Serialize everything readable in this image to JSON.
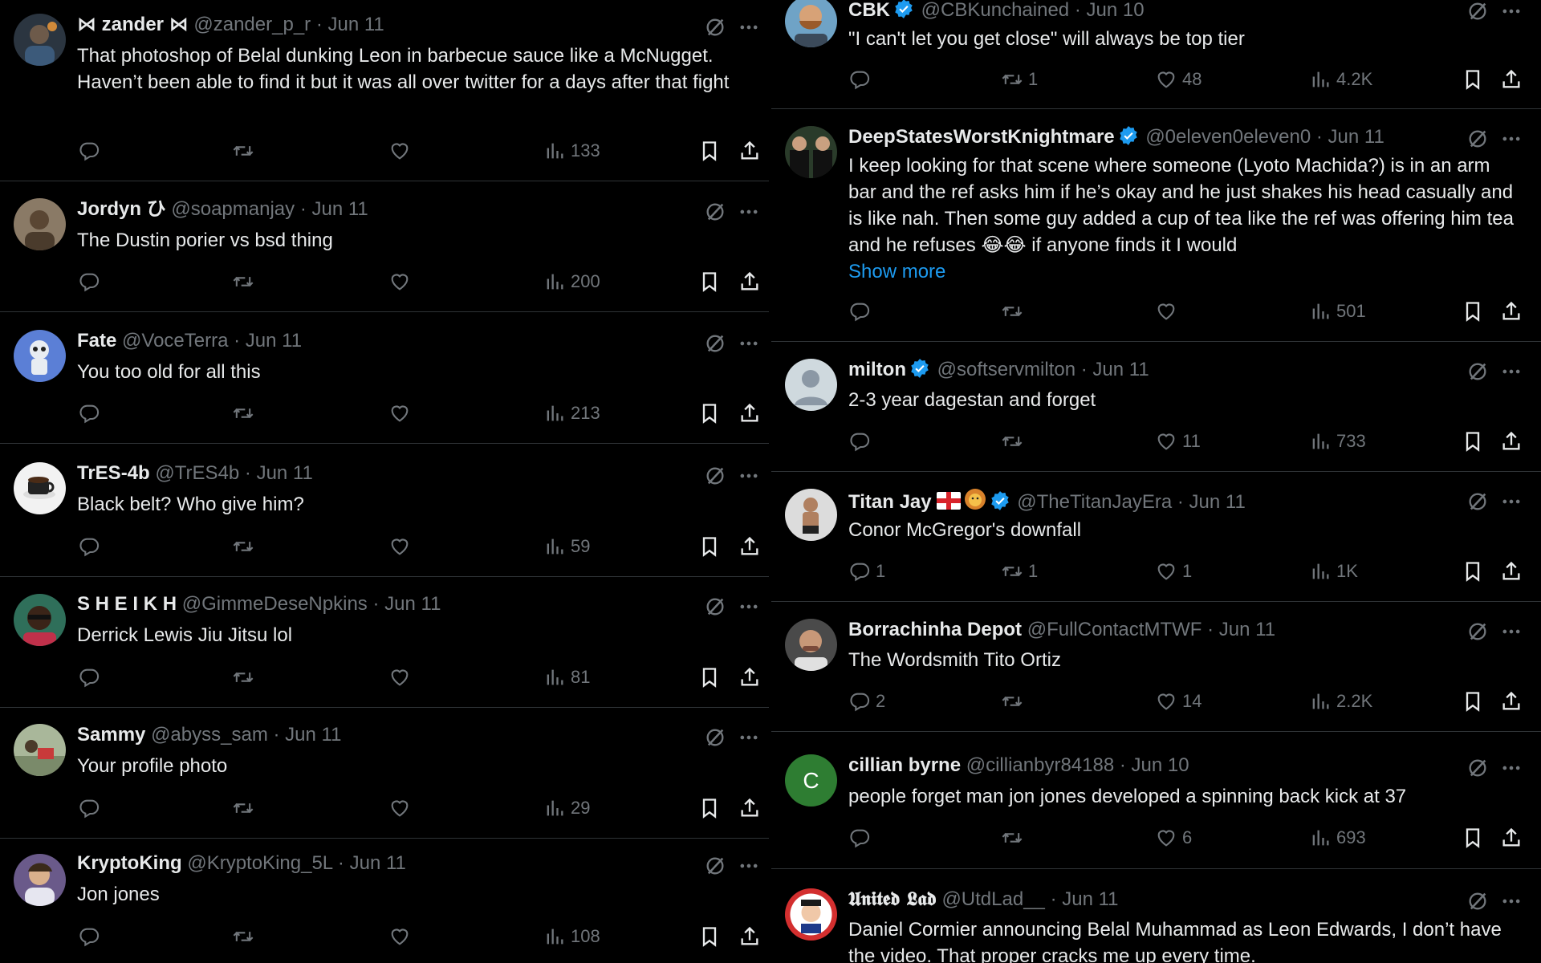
{
  "colors": {
    "background": "#000000",
    "text": "#e7e9ea",
    "secondary": "#71767b",
    "link": "#1d9bf0",
    "verified": "#1d9bf0",
    "border": "#2f3336"
  },
  "left_tweets": [
    {
      "name": "⋈ zander ⋈",
      "handle": "@zander_p_r",
      "date": "Jun 11",
      "text": "That photoshop of Belal dunking Leon in barbecue sauce like a McNugget. Haven’t been able to find it but it was all over twitter for a days after that fight",
      "replies": "",
      "reposts": "",
      "likes": "",
      "views": "133"
    },
    {
      "name": "Jordyn ひ",
      "handle": "@soapmanjay",
      "date": "Jun 11",
      "text": "The Dustin porier vs bsd thing",
      "replies": "",
      "reposts": "",
      "likes": "",
      "views": "200"
    },
    {
      "name": "Fate",
      "handle": "@VoceTerra",
      "date": "Jun 11",
      "text": "You too old for all this",
      "replies": "",
      "reposts": "",
      "likes": "",
      "views": "213"
    },
    {
      "name": "TrES-4b",
      "handle": "@TrES4b",
      "date": "Jun 11",
      "text": "Black belt? Who give him?",
      "replies": "",
      "reposts": "",
      "likes": "",
      "views": "59"
    },
    {
      "name": "S H E I K H",
      "handle": "@GimmeDeseNpkins",
      "date": "Jun 11",
      "text": "Derrick Lewis Jiu Jitsu lol",
      "replies": "",
      "reposts": "",
      "likes": "",
      "views": "81"
    },
    {
      "name": "Sammy",
      "handle": "@abyss_sam",
      "date": "Jun 11",
      "text": "Your profile photo",
      "replies": "",
      "reposts": "",
      "likes": "",
      "views": "29"
    },
    {
      "name": "KryptoKing",
      "handle": "@KryptoKing_5L",
      "date": "Jun 11",
      "text": "Jon jones",
      "replies": "",
      "reposts": "",
      "likes": "",
      "views": "108"
    }
  ],
  "right_tweets": [
    {
      "name": "CBK",
      "handle": "@CBKunchained",
      "date": "Jun 10",
      "verified": true,
      "text": "\"I can't let you get close\" will always be top tier",
      "replies": "",
      "reposts": "1",
      "likes": "48",
      "views": "4.2K"
    },
    {
      "name": "DeepStatesWorstKnightmare",
      "handle": "@0eleven0eleven0",
      "date": "Jun 11",
      "verified": true,
      "text": "I keep looking for that scene where someone (Lyoto Machida?) is in an arm bar and the ref asks him if he’s okay and he just shakes his head casually and is like nah. Then some guy added a cup of tea like the ref was offering him tea and he refuses 😂😂 if anyone finds it I would",
      "show_more": "Show more",
      "replies": "",
      "reposts": "",
      "likes": "",
      "views": "501"
    },
    {
      "name": "milton",
      "handle": "@softservmilton",
      "date": "Jun 11",
      "verified": true,
      "text": "2-3 year dagestan and forget",
      "replies": "",
      "reposts": "",
      "likes": "11",
      "views": "733"
    },
    {
      "name": "Titan Jay",
      "handle": "@TheTitanJayEra",
      "date": "Jun 11",
      "verified": true,
      "text": "Conor McGregor's downfall",
      "replies": "1",
      "reposts": "1",
      "likes": "1",
      "views": "1K"
    },
    {
      "name": "Borrachinha Depot",
      "handle": "@FullContactMTWF",
      "date": "Jun 11",
      "text": "The Wordsmith Tito Ortiz",
      "replies": "2",
      "reposts": "",
      "likes": "14",
      "views": "2.2K"
    },
    {
      "name": "cillian byrne",
      "handle": "@cillianbyr84188",
      "date": "Jun 10",
      "avatar_letter": "C",
      "text": "people forget man jon jones developed a spinning back kick at 37",
      "replies": "",
      "reposts": "",
      "likes": "6",
      "views": "693"
    },
    {
      "name": "𝖀𝖓𝖎𝖙𝖊𝖉 𝕷𝖆𝖉",
      "handle": "@UtdLad__",
      "date": "Jun 11",
      "text": "Daniel Cormier announcing Belal Muhammad as Leon Edwards, I don’t have the video. That proper cracks me up every time.",
      "replies": "",
      "reposts": "",
      "likes": "",
      "views": ""
    }
  ]
}
